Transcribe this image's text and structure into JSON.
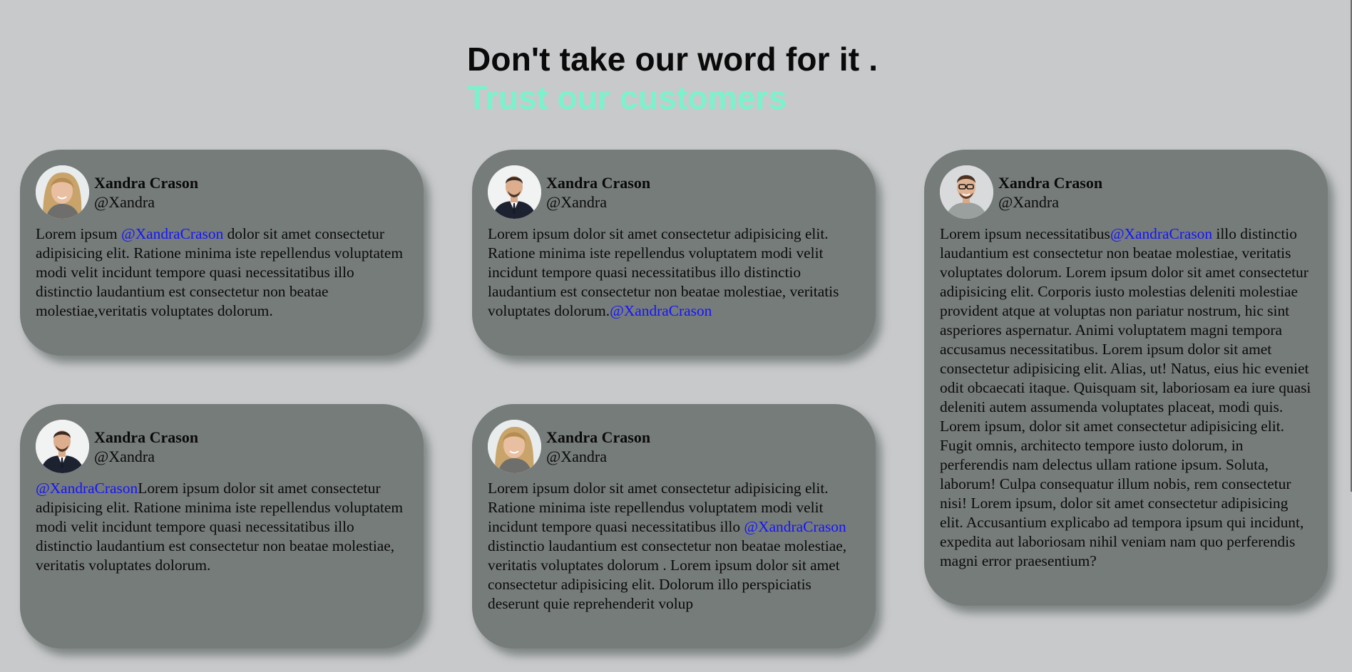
{
  "heading": {
    "line1": "Don't take our word for it .",
    "line2": "Trust our customers"
  },
  "cards": [
    {
      "name": "Xandra Crason",
      "handle": "@Xandra",
      "avatar": "woman-blonde-avatar",
      "text_before": "Lorem ipsum ",
      "mention": "@XandraCrason",
      "text_after": " dolor sit amet consectetur adipisicing elit. Ratione minima iste repellendus voluptatem modi velit incidunt tempore quasi necessitatibus illo distinctio laudantium est consectetur non beatae molestiae,veritatis voluptates dolorum."
    },
    {
      "name": "Xandra Crason",
      "handle": "@Xandra",
      "avatar": "man-suit-avatar",
      "text_before": "Lorem ipsum dolor sit amet consectetur adipisicing elit. Ratione minima iste repellendus voluptatem modi velit incidunt tempore quasi necessitatibus illo distinctio laudantium est consectetur non beatae molestiae, veritatis voluptates dolorum.",
      "mention": "@XandraCrason",
      "text_after": ""
    },
    {
      "name": "Xandra Crason",
      "handle": "@Xandra",
      "avatar": "man-glasses-avatar",
      "text_before": "Lorem ipsum necessitatibus",
      "mention": "@XandraCrason",
      "text_after": " illo distinctio laudantium est consectetur non beatae molestiae, veritatis voluptates dolorum. Lorem ipsum dolor sit amet consectetur adipisicing elit. Corporis iusto molestias deleniti molestiae provident atque at voluptas non pariatur nostrum, hic sint asperiores aspernatur. Animi voluptatem magni tempora accusamus necessitatibus. Lorem ipsum dolor sit amet consectetur adipisicing elit. Alias, ut! Natus, eius hic eveniet odit obcaecati itaque. Quisquam sit, laboriosam ea iure quasi deleniti autem assumenda voluptates placeat, modi quis. Lorem ipsum, dolor sit amet consectetur adipisicing elit. Fugit omnis, architecto tempore iusto dolorum, in perferendis nam delectus ullam ratione ipsum. Soluta, laborum! Culpa consequatur illum nobis, rem consectetur nisi! Lorem ipsum, dolor sit amet consectetur adipisicing elit. Accusantium explicabo ad tempora ipsum qui incidunt, expedita aut laboriosam nihil veniam nam quo perferendis magni error praesentium?"
    },
    {
      "name": "Xandra Crason",
      "handle": "@Xandra",
      "avatar": "man-suit-avatar",
      "text_before": "",
      "mention": "@XandraCrason",
      "text_after": "Lorem ipsum dolor sit amet consectetur adipisicing elit. Ratione minima iste repellendus voluptatem modi velit incidunt tempore quasi necessitatibus illo distinctio laudantium est consectetur non beatae molestiae, veritatis voluptates dolorum."
    },
    {
      "name": "Xandra Crason",
      "handle": "@Xandra",
      "avatar": "woman-blonde-avatar",
      "text_before": "Lorem ipsum dolor sit amet consectetur adipisicing elit. Ratione minima iste repellendus voluptatem modi velit incidunt tempore quasi necessitatibus illo ",
      "mention": "@XandraCrason",
      "text_after": " distinctio laudantium est consectetur non beatae molestiae, veritatis voluptates dolorum . Lorem ipsum dolor sit amet consectetur adipisicing elit. Dolorum illo perspiciatis deserunt quie reprehenderit volup"
    }
  ],
  "colors": {
    "background": "#c8c9cb",
    "card": "#767c7a",
    "accent": "#7cf2cc",
    "mention": "#1414ff"
  }
}
